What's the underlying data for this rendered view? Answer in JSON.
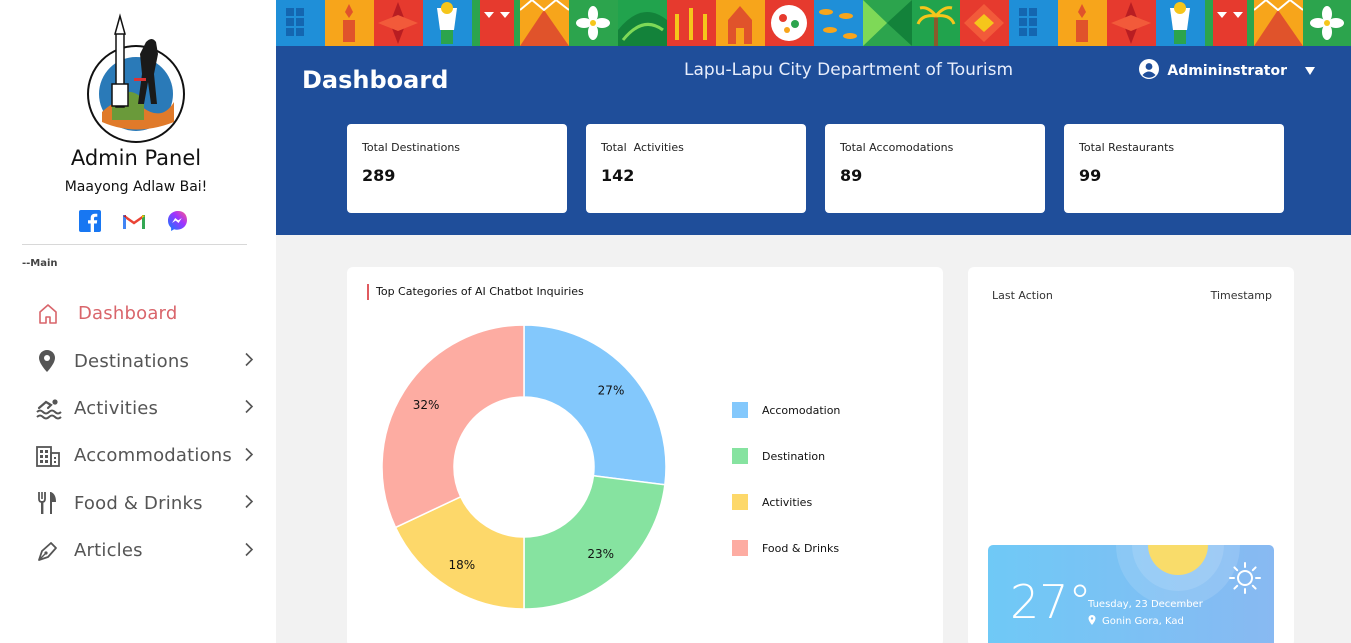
{
  "sidebar": {
    "title": "Admin Panel",
    "greeting": "Maayong Adlaw Bai!",
    "section_label": "--Main",
    "items": [
      {
        "label": "Dashboard",
        "icon": "home-icon",
        "active": true
      },
      {
        "label": "Destinations",
        "icon": "map-pin-icon"
      },
      {
        "label": "Activities",
        "icon": "swimmer-icon"
      },
      {
        "label": "Accommodations",
        "icon": "building-icon"
      },
      {
        "label": "Food & Drinks",
        "icon": "utensils-icon"
      },
      {
        "label": "Articles",
        "icon": "pen-icon"
      }
    ],
    "socials": [
      "facebook-icon",
      "gmail-icon",
      "messenger-icon"
    ]
  },
  "header": {
    "page_title": "Dashboard",
    "org_title": "Lapu-Lapu City Department of Tourism",
    "user_name": "Admininstrator"
  },
  "stats": [
    {
      "label": "Total Destinations",
      "value": "289"
    },
    {
      "label": "Total  Activities",
      "value": "142"
    },
    {
      "label": "Total Accomodations",
      "value": "89"
    },
    {
      "label": "Total Restaurants",
      "value": "99"
    }
  ],
  "chart_panel": {
    "title": "Top Categories of AI Chatbot Inquiries"
  },
  "chart_data": {
    "type": "pie",
    "categories": [
      "Accomodation",
      "Destination",
      "Activities",
      "Food & Drinks"
    ],
    "values": [
      27,
      23,
      18,
      32
    ],
    "labels": [
      "27%",
      "23%",
      "18%",
      "32%"
    ],
    "colors": [
      "#83c8fc",
      "#86e3a0",
      "#fdd86a",
      "#fdaca2"
    ],
    "legend": "right"
  },
  "activity": {
    "col1": "Last Action",
    "col2": "Timestamp"
  },
  "weather": {
    "temperature": "27°",
    "date": "Tuesday, 23 December",
    "location": "Gonin Gora, Kad"
  },
  "colors": {
    "header_blue": "#1f4e9a",
    "active_nav": "#d9656b",
    "accent_red": "#e05a5f"
  }
}
